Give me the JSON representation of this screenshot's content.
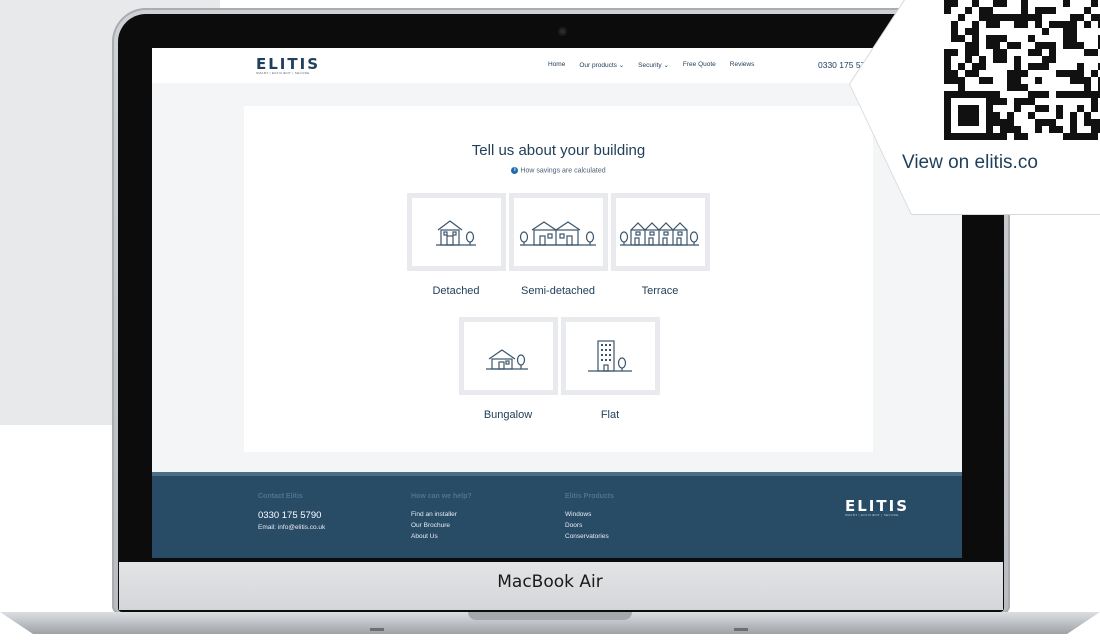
{
  "laptop": {
    "brand": "MacBook Air"
  },
  "site": {
    "logo": {
      "mark": "ELITIS",
      "tagline": "SMART | EFFICIENT | SECURE"
    },
    "nav": {
      "items": [
        "Home",
        "Our products ⌄",
        "Security ⌄",
        "Free Quote",
        "Reviews"
      ],
      "phone": "0330 175 57"
    },
    "heading": "Tell us about your building",
    "hint": "How savings are calculated",
    "options": [
      {
        "label": "Detached",
        "icon": "detached-house-icon"
      },
      {
        "label": "Semi-detached",
        "icon": "semi-detached-house-icon"
      },
      {
        "label": "Terrace",
        "icon": "terrace-house-icon"
      },
      {
        "label": "Bungalow",
        "icon": "bungalow-icon"
      },
      {
        "label": "Flat",
        "icon": "flat-building-icon"
      }
    ],
    "footer": {
      "contact": {
        "heading": "Contact Elitis",
        "phone": "0330 175 5790",
        "email": "Email: info@elitis.co.uk"
      },
      "help": {
        "heading": "How can we help?",
        "links": [
          "Find an installer",
          "Our Brochure",
          "About Us"
        ]
      },
      "products": {
        "heading": "Elitis Products",
        "links": [
          "Windows",
          "Doors",
          "Conservatories"
        ]
      }
    }
  },
  "qr_overlay": {
    "caption": "View on elitis.co"
  },
  "colors": {
    "navy": "#23405a",
    "footer": "#284b66",
    "accent": "#1f6bb0"
  }
}
